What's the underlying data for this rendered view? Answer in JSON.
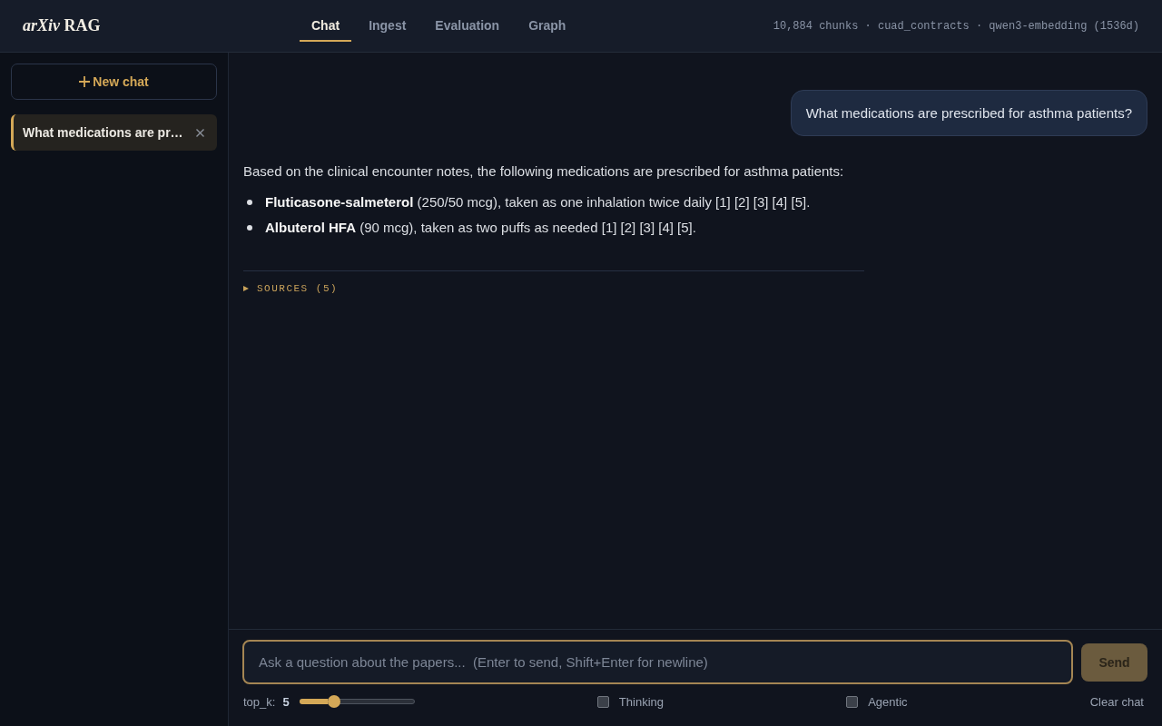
{
  "header": {
    "logo": "*arXiv* RAG",
    "tabs": [
      {
        "label": "Chat",
        "selected": true
      },
      {
        "label": "Ingest",
        "selected": false
      },
      {
        "label": "Evaluation",
        "selected": false
      },
      {
        "label": "Graph",
        "selected": false
      }
    ],
    "status": "10,884 chunks · cuad_contracts · qwen3-embedding (1536d)"
  },
  "sidebar": {
    "new_chat_button": "New chat",
    "conversations": [
      {
        "title": "What medications are pr…",
        "selected": true
      }
    ]
  },
  "chat": {
    "messages": [
      {
        "kind": "user",
        "text": "What medications are prescribed for asthma patients?"
      },
      {
        "kind": "assistant",
        "intro": "Based on the clinical encounter notes, the following medications are prescribed for asthma patients:",
        "items": [
          "**Fluticasone-salmeterol** (250/50 mcg), taken as one inhalation twice daily [1] [2] [3] [4] [5].",
          "**Albuterol HFA** (90 mcg), taken as two puffs as needed [1] [2] [3] [4] [5]."
        ],
        "sources": {
          "label": "SOURCES (5)",
          "expanded": false
        }
      }
    ]
  },
  "composer": {
    "placeholder": "Ask a question about the papers...  (Enter to send, Shift+Enter for newline)",
    "send_button": "Send",
    "top_k": {
      "label": "top_k:",
      "value": "5",
      "level": 0.3
    },
    "options": [
      {
        "label": "Thinking",
        "checked": false
      },
      {
        "label": "Agentic",
        "checked": false
      }
    ],
    "clear_button": "Clear chat"
  }
}
